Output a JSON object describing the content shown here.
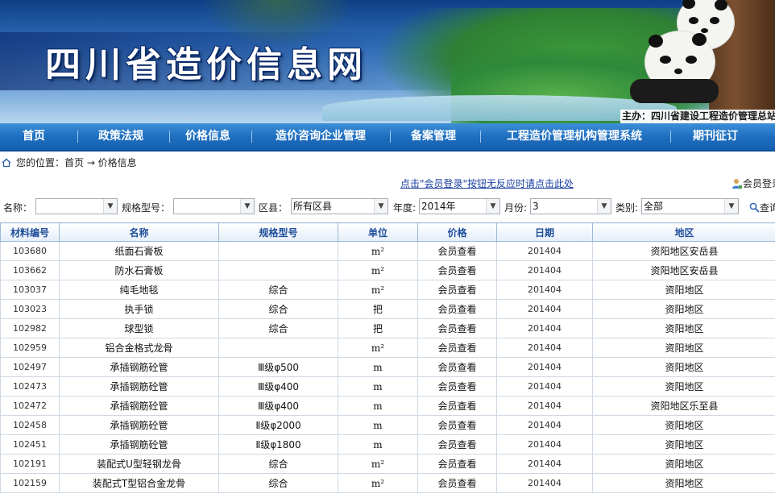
{
  "header": {
    "site_title": "四川省造价信息网",
    "sponsor": "主办：四川省建设工程造价管理总站"
  },
  "nav": {
    "items": [
      "首页",
      "政策法规",
      "价格信息",
      "造价咨询企业管理",
      "备案管理",
      "工程造价管理机构管理系统",
      "期刊征订"
    ]
  },
  "breadcrumb": {
    "label": "您的位置：首页 → 价格信息"
  },
  "notice": {
    "login_hint": "点击\"会员登录\"按钮无反应时请点击此处",
    "member_login": "会员登录"
  },
  "filters": {
    "name_label": "名称：",
    "name_value": "",
    "spec_label": "规格型号：",
    "spec_value": "",
    "county_label": "区县：",
    "county_value": "所有区县",
    "year_label": "年度:",
    "year_value": "2014年",
    "month_label": "月份:",
    "month_value": "3",
    "category_label": "类别:",
    "category_value": "全部",
    "search_label": "查询"
  },
  "table": {
    "headers": [
      "材料编号",
      "名称",
      "规格型号",
      "单位",
      "价格",
      "日期",
      "地区"
    ],
    "rows": [
      [
        "103680",
        "纸面石膏板",
        "",
        "m²",
        "会员查看",
        "201404",
        "资阳地区安岳县"
      ],
      [
        "103662",
        "防水石膏板",
        "",
        "m²",
        "会员查看",
        "201404",
        "资阳地区安岳县"
      ],
      [
        "103037",
        "纯毛地毯",
        "综合",
        "m²",
        "会员查看",
        "201404",
        "资阳地区"
      ],
      [
        "103023",
        "执手锁",
        "综合",
        "把",
        "会员查看",
        "201404",
        "资阳地区"
      ],
      [
        "102982",
        "球型锁",
        "综合",
        "把",
        "会员查看",
        "201404",
        "资阳地区"
      ],
      [
        "102959",
        "铝合金格式龙骨",
        "",
        "m²",
        "会员查看",
        "201404",
        "资阳地区"
      ],
      [
        "102497",
        "承插钢筋砼管",
        "Ⅲ级φ500",
        "m",
        "会员查看",
        "201404",
        "资阳地区"
      ],
      [
        "102473",
        "承插钢筋砼管",
        "Ⅲ级φ400",
        "m",
        "会员查看",
        "201404",
        "资阳地区"
      ],
      [
        "102472",
        "承插钢筋砼管",
        "Ⅲ级φ400",
        "m",
        "会员查看",
        "201404",
        "资阳地区乐至县"
      ],
      [
        "102458",
        "承插钢筋砼管",
        "Ⅱ级φ2000",
        "m",
        "会员查看",
        "201404",
        "资阳地区"
      ],
      [
        "102451",
        "承插钢筋砼管",
        "Ⅱ级φ1800",
        "m",
        "会员查看",
        "201404",
        "资阳地区"
      ],
      [
        "102191",
        "装配式U型轻钢龙骨",
        "综合",
        "m²",
        "会员查看",
        "201404",
        "资阳地区"
      ],
      [
        "102159",
        "装配式T型铝合金龙骨",
        "综合",
        "m²",
        "会员查看",
        "201404",
        "资阳地区"
      ]
    ]
  },
  "colors": {
    "nav_bg": "#1f6fc0",
    "header_text": "#1f4e9a",
    "link": "#1a3fa0"
  }
}
